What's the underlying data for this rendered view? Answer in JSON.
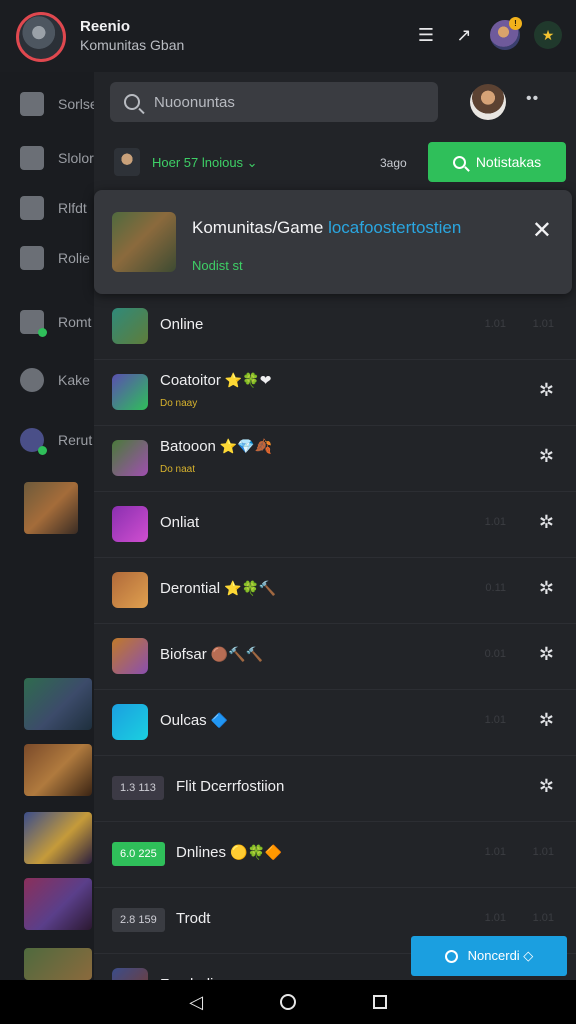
{
  "header": {
    "title": "Reenio",
    "subtitle": "Komunitas Gban"
  },
  "rail": {
    "items": [
      {
        "label": "Sorlse"
      },
      {
        "label": "Slolor"
      },
      {
        "label": "Rlfdt"
      },
      {
        "label": "Rolie"
      },
      {
        "label": "Romt"
      },
      {
        "label": "Kake"
      },
      {
        "label": "Rerut"
      }
    ]
  },
  "panel": {
    "search_placeholder": "Nuoonuntas",
    "filter_text": "Hoer 57 lnoious ⌄",
    "filter_count": "3ago",
    "action_button": "Notistakas",
    "card": {
      "title": "Komunitas/Game",
      "link": " locafoostertostien",
      "status": "Nodist st"
    },
    "rows": [
      {
        "name": "Online",
        "sub": "",
        "emoji": "",
        "ghost": "1.01",
        "ghost2": "1.01",
        "gear": false
      },
      {
        "name": "Coatoitor",
        "sub": "Do naay",
        "emoji": "⭐🍀❤",
        "ghost": "",
        "ghost2": "",
        "gear": true
      },
      {
        "name": "Batooon",
        "sub": "Do naat",
        "emoji": "⭐💎🍂",
        "ghost": "",
        "ghost2": "",
        "gear": true
      },
      {
        "name": "Onliat",
        "sub": "",
        "emoji": "",
        "ghost": "1.01",
        "ghost2": "",
        "gear": true
      },
      {
        "name": "Derontial",
        "sub": "",
        "emoji": "⭐🍀🔨",
        "ghost": "0.11",
        "ghost2": "",
        "gear": true
      },
      {
        "name": "Biofsar",
        "sub": "",
        "emoji": "🟤🔨🔨",
        "ghost": "0.01",
        "ghost2": "",
        "gear": true
      },
      {
        "name": "Oulcas",
        "sub": "",
        "emoji": "🔷",
        "ghost": "1.01",
        "ghost2": "",
        "gear": true
      },
      {
        "name": "Flit Dcerrfostiion",
        "sub": "",
        "emoji": "",
        "pill": "1.3 113",
        "pill_bg": "#3c3a45",
        "pill_fg": "#cfcfd6",
        "ghost": "",
        "ghost2": "",
        "gear": true
      },
      {
        "name": "Dnlines",
        "sub": "",
        "emoji": "🟡🍀🔶",
        "pill": "6.0 225",
        "pill_bg": "#2fbf5a",
        "pill_fg": "#ffffff",
        "ghost": "1.01",
        "ghost2": "1.01",
        "gear": false
      },
      {
        "name": "Trodt",
        "sub": "",
        "emoji": "",
        "pill": "2.8 159",
        "pill_bg": "#3a3c42",
        "pill_fg": "#cfcfd6",
        "ghost": "1.01",
        "ghost2": "1.01",
        "gear": false
      },
      {
        "name": "Fun baliner ~",
        "sub": "",
        "emoji": "",
        "ghost": "",
        "ghost2": "",
        "gear": false
      }
    ]
  },
  "fab": {
    "label": "Noncerdi ◇"
  },
  "colors": {
    "accent_green": "#2fbf5a",
    "accent_blue": "#1b9fe0",
    "avatar_ring": "#e0484f"
  }
}
